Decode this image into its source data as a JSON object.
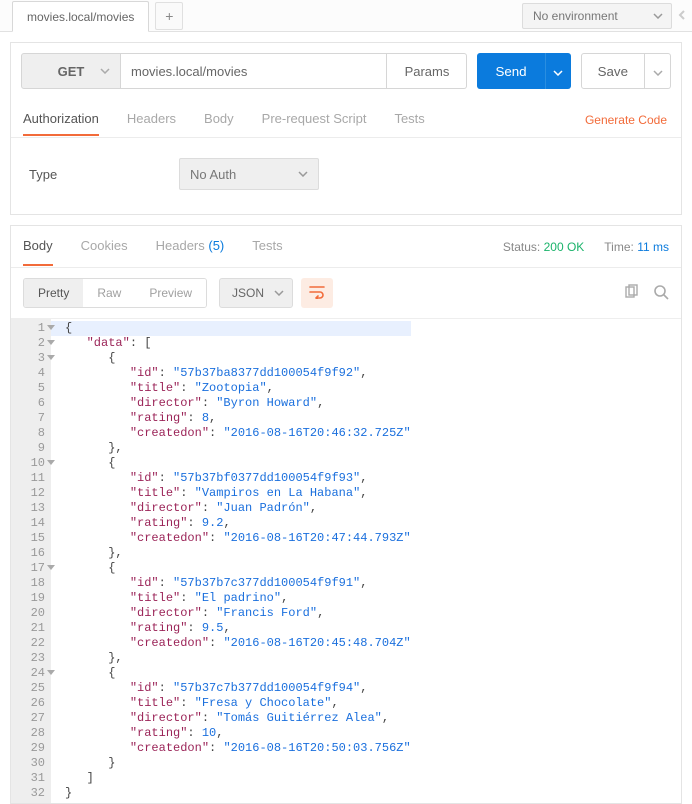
{
  "top": {
    "tab_title": "movies.local/movies",
    "new_tab_glyph": "+",
    "env_label": "No environment"
  },
  "request": {
    "method": "GET",
    "url": "movies.local/movies",
    "params_btn": "Params",
    "send_btn": "Send",
    "save_btn": "Save",
    "tabs": {
      "authorization": "Authorization",
      "headers": "Headers",
      "body": "Body",
      "prerequest": "Pre-request Script",
      "tests": "Tests"
    },
    "generate_code": "Generate Code",
    "auth_type_label": "Type",
    "auth_value": "No Auth"
  },
  "response": {
    "tabs": {
      "body": "Body",
      "cookies": "Cookies",
      "headers": "Headers",
      "headers_count": "(5)",
      "tests": "Tests"
    },
    "status_label": "Status:",
    "status_value": "200 OK",
    "time_label": "Time:",
    "time_value": "11 ms",
    "viewmodes": {
      "pretty": "Pretty",
      "raw": "Raw",
      "preview": "Preview"
    },
    "lang": "JSON"
  },
  "json_body": {
    "data": [
      {
        "id": "57b37ba8377dd100054f9f92",
        "title": "Zootopia",
        "director": "Byron Howard",
        "rating": 8,
        "createdon": "2016-08-16T20:46:32.725Z"
      },
      {
        "id": "57b37bf0377dd100054f9f93",
        "title": "Vampiros en La Habana",
        "director": "Juan Padrón",
        "rating": 9.2,
        "createdon": "2016-08-16T20:47:44.793Z"
      },
      {
        "id": "57b37b7c377dd100054f9f91",
        "title": "El padrino",
        "director": "Francis Ford",
        "rating": 9.5,
        "createdon": "2016-08-16T20:45:48.704Z"
      },
      {
        "id": "57b37c7b377dd100054f9f94",
        "title": "Fresa y Chocolate",
        "director": "Tomás Guitiérrez Alea",
        "rating": 10,
        "createdon": "2016-08-16T20:50:03.756Z"
      }
    ]
  }
}
